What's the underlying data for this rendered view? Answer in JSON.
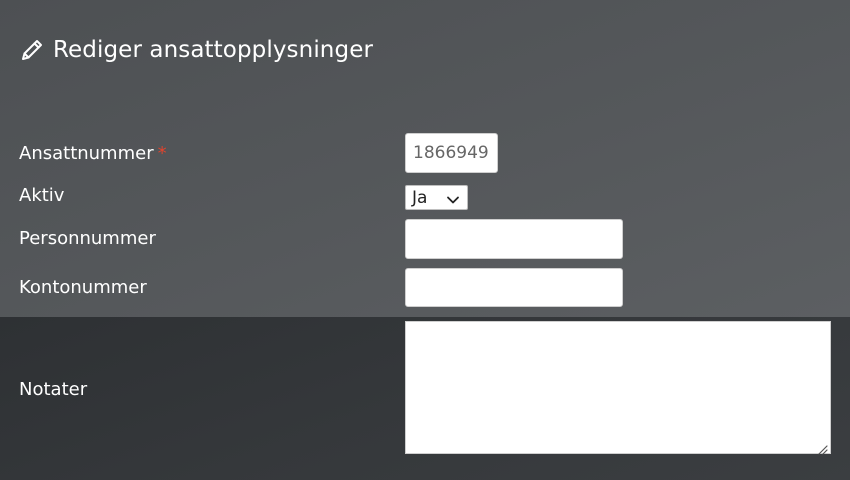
{
  "header": {
    "icon": "pencil-icon",
    "title": "Rediger ansattopplysninger"
  },
  "form": {
    "employee_number": {
      "label": "Ansattnummer",
      "required_mark": "*",
      "value": "1866949"
    },
    "active": {
      "label": "Aktiv",
      "selected": "Ja"
    },
    "personal_number": {
      "label": "Personnummer",
      "value": ""
    },
    "account_number": {
      "label": "Kontonummer",
      "value": ""
    },
    "notes": {
      "label": "Notater",
      "value": ""
    }
  },
  "colors": {
    "required": "#e0442e",
    "background_top": "#55585b",
    "background_bottom": "#35383b"
  }
}
